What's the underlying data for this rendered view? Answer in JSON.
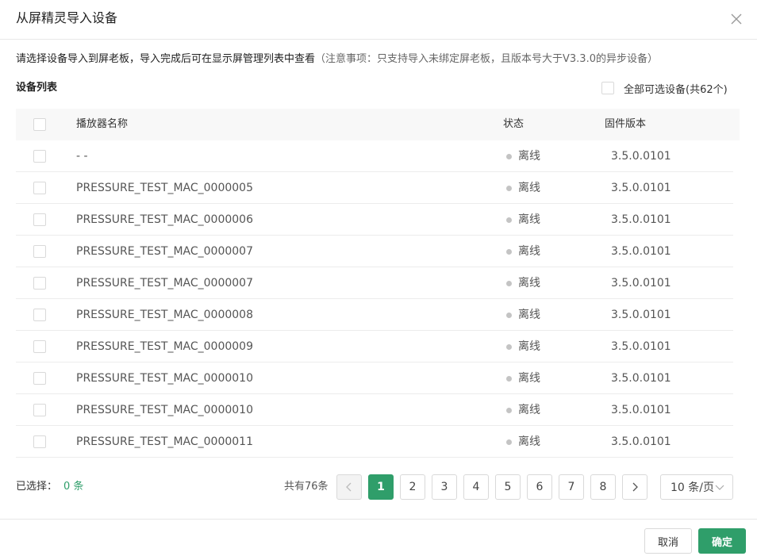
{
  "dialog": {
    "title": "从屏精灵导入设备",
    "close_icon": "close-icon"
  },
  "notice": {
    "main": "请选择设备导入到屏老板，导入完成后可在显示屏管理列表中查看",
    "note": "（注意事项：只支持导入未绑定屏老板，且版本号大于V3.3.0的异步设备）"
  },
  "device_list": {
    "title": "设备列表",
    "select_all_label": "全部可选设备(共62个)",
    "columns": {
      "name": "播放器名称",
      "status": "状态",
      "version": "固件版本"
    },
    "rows": [
      {
        "name": "- -",
        "status": "离线",
        "version": "3.5.0.0101"
      },
      {
        "name": "PRESSURE_TEST_MAC_0000005",
        "status": "离线",
        "version": "3.5.0.0101"
      },
      {
        "name": "PRESSURE_TEST_MAC_0000006",
        "status": "离线",
        "version": "3.5.0.0101"
      },
      {
        "name": "PRESSURE_TEST_MAC_0000007",
        "status": "离线",
        "version": "3.5.0.0101"
      },
      {
        "name": "PRESSURE_TEST_MAC_0000007",
        "status": "离线",
        "version": "3.5.0.0101"
      },
      {
        "name": "PRESSURE_TEST_MAC_0000008",
        "status": "离线",
        "version": "3.5.0.0101"
      },
      {
        "name": "PRESSURE_TEST_MAC_0000009",
        "status": "离线",
        "version": "3.5.0.0101"
      },
      {
        "name": "PRESSURE_TEST_MAC_0000010",
        "status": "离线",
        "version": "3.5.0.0101"
      },
      {
        "name": "PRESSURE_TEST_MAC_0000010",
        "status": "离线",
        "version": "3.5.0.0101"
      },
      {
        "name": "PRESSURE_TEST_MAC_0000011",
        "status": "离线",
        "version": "3.5.0.0101"
      }
    ]
  },
  "selection": {
    "label": "已选择：",
    "count": "0 条"
  },
  "pagination": {
    "total": "共有76条",
    "pages": [
      "1",
      "2",
      "3",
      "4",
      "5",
      "6",
      "7",
      "8"
    ],
    "current": "1",
    "page_size": "10 条/页"
  },
  "footer": {
    "cancel_label": "取消",
    "ok_label": "确定"
  },
  "colors": {
    "accent": "#2f9e6a",
    "offline_dot": "#c4c4c4"
  }
}
